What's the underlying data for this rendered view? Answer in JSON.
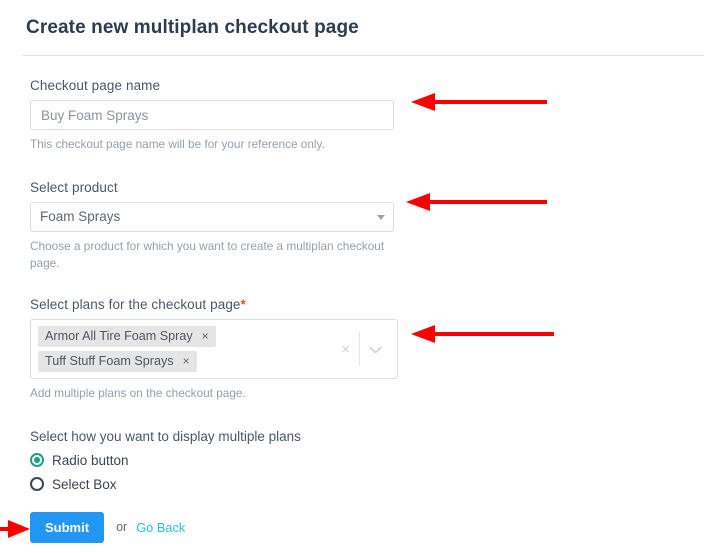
{
  "header": {
    "title": "Create new multiplan checkout page"
  },
  "form": {
    "checkout_name": {
      "label": "Checkout page name",
      "value": "Buy Foam Sprays",
      "placeholder": "Buy Foam Sprays",
      "help": "This checkout page name will be for your reference only."
    },
    "product": {
      "label": "Select product",
      "selected": "Foam Sprays",
      "help": "Choose a product for which you want to create a multiplan checkout page.",
      "caret_icon": "caret-down-icon"
    },
    "plans": {
      "label": "Select plans for the checkout page",
      "required_marker": "*",
      "tags": [
        {
          "label": "Armor All Tire Foam Spray",
          "remove_icon": "×"
        },
        {
          "label": "Tuff Stuff Foam Sprays",
          "remove_icon": "×"
        }
      ],
      "clear_icon": "×",
      "chevron_icon": "⌄",
      "help": "Add multiple plans on the checkout page."
    },
    "display_mode": {
      "label": "Select how you want to display multiple plans",
      "options": [
        {
          "label": "Radio button",
          "checked": true
        },
        {
          "label": "Select Box",
          "checked": false
        }
      ]
    }
  },
  "footer": {
    "submit_label": "Submit",
    "or_label": "or",
    "go_back_label": "Go Back"
  },
  "colors": {
    "submit_blue": "#2196f3",
    "link_teal": "#2cc0d8",
    "radio_teal": "#16a085",
    "required_red": "#e8453c",
    "annotation_red": "#fb0000",
    "help_text": "#93a1ad"
  },
  "annotations": [
    {
      "name": "arrow-to-checkout-name-input",
      "direction": "left"
    },
    {
      "name": "arrow-to-product-select",
      "direction": "left"
    },
    {
      "name": "arrow-to-plans-multiselect",
      "direction": "left"
    },
    {
      "name": "arrow-to-submit-button",
      "direction": "right"
    }
  ]
}
